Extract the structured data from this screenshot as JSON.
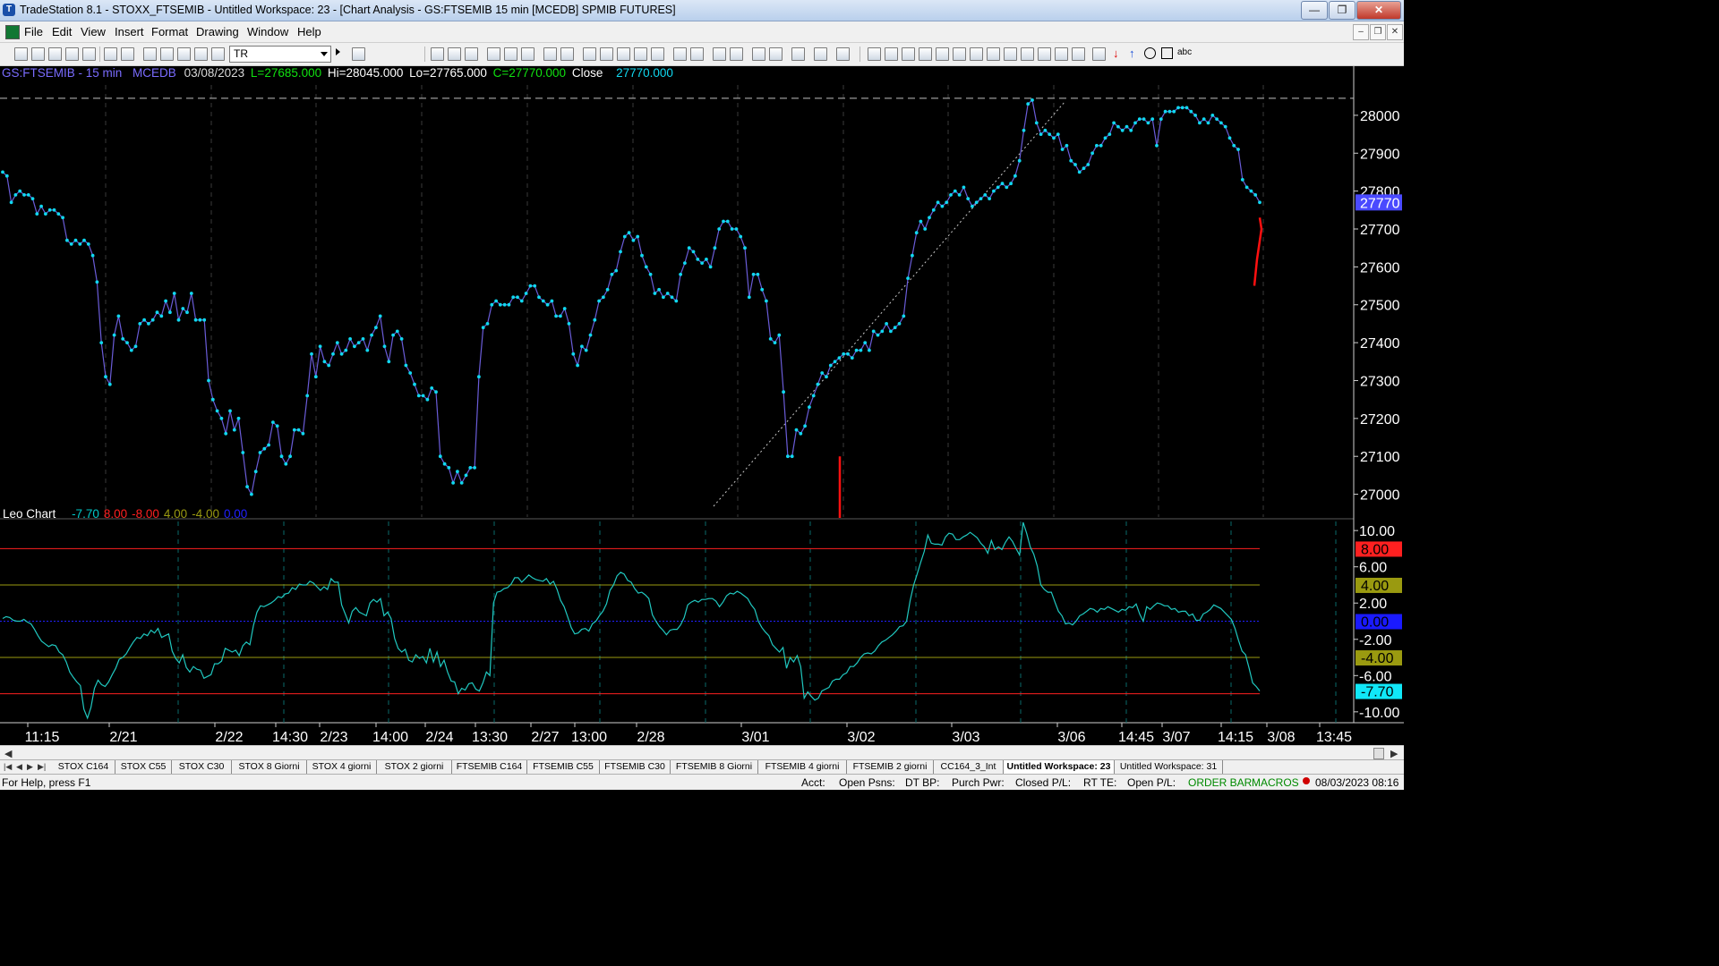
{
  "window": {
    "title": "TradeStation 8.1 - STOXX_FTSEMIB - Untitled Workspace:  23 - [Chart Analysis - GS:FTSEMIB  15 min  [MCEDB] SPMIB FUTURES]"
  },
  "menu": [
    "File",
    "Edit",
    "View",
    "Insert",
    "Format",
    "Drawing",
    "Window",
    "Help"
  ],
  "toolbar": {
    "symbol_value": "TR"
  },
  "chart_header": {
    "symbol": "GS:FTSEMIB - 15 min",
    "exchange": "MCEDB",
    "date": "03/08/2023",
    "last": "L=27685.000",
    "high": "Hi=28045.000",
    "low": "Lo=27765.000",
    "close_eq": "C=27770.000",
    "close_label": "Close",
    "close_value": "27770.000"
  },
  "indicator_header": {
    "name": "Leo Chart",
    "values": [
      {
        "text": "-7.70",
        "color": "#00c8c8"
      },
      {
        "text": "8.00",
        "color": "#ff2020"
      },
      {
        "text": "-8.00",
        "color": "#ff2020"
      },
      {
        "text": "4.00",
        "color": "#9a9a10"
      },
      {
        "text": "-4.00",
        "color": "#9a9a10"
      },
      {
        "text": "0.00",
        "color": "#2020ff"
      }
    ]
  },
  "colors": {
    "price_line": "#6a5cd8",
    "price_marker": "#10d8f0",
    "indicator": "#20c8c0",
    "up_level": "#ff2020",
    "mid_level": "#9a9a10",
    "zero_level": "#2020ff",
    "axis_text": "#ffffff",
    "red_bar": "#ff1010"
  },
  "price_axis": {
    "ticks": [
      "28000",
      "27900",
      "27800",
      "27700",
      "27600",
      "27500",
      "27400",
      "27300",
      "27200",
      "27100",
      "27000"
    ],
    "current_label": "27770"
  },
  "indicator_axis": {
    "ticks": [
      "10.00",
      "6.00",
      "2.00",
      "-2.00",
      "-6.00",
      "-10.00"
    ],
    "level_labels": [
      {
        "text": "8.00",
        "bg": "#ff2020",
        "fg": "#000000"
      },
      {
        "text": "4.00",
        "bg": "#9a9a10",
        "fg": "#000000"
      },
      {
        "text": "0.00",
        "bg": "#1a1aff",
        "fg": "#000000"
      },
      {
        "text": "-4.00",
        "bg": "#9a9a10",
        "fg": "#000000"
      },
      {
        "text": "-7.70",
        "bg": "#10e8f8",
        "fg": "#000000"
      }
    ]
  },
  "time_axis": [
    "11:15",
    "2/21",
    "2/22",
    "14:30",
    "2/23",
    "14:00",
    "2/24",
    "13:30",
    "2/27",
    "13:00",
    "2/28",
    "3/01",
    "3/02",
    "3/03",
    "3/06",
    "14:45",
    "3/07",
    "14:15",
    "3/08",
    "13:45"
  ],
  "tabs": [
    {
      "label": "STOX C164",
      "active": false
    },
    {
      "label": "STOX C55",
      "active": false
    },
    {
      "label": "STOX  C30",
      "active": false
    },
    {
      "label": "STOX  8 Giorni",
      "active": false
    },
    {
      "label": "STOX 4 giorni",
      "active": false
    },
    {
      "label": "STOX  2 giorni",
      "active": false
    },
    {
      "label": "FTSEMIB C164",
      "active": false
    },
    {
      "label": "FTSEMIB C55",
      "active": false
    },
    {
      "label": "FTSEMIB C30",
      "active": false
    },
    {
      "label": "FTSEMIB  8 Giorni",
      "active": false
    },
    {
      "label": "FTSEMIB  4 giorni",
      "active": false
    },
    {
      "label": "FTSEMIB  2 giorni",
      "active": false
    },
    {
      "label": "CC164_3_Int",
      "active": false
    },
    {
      "label": "Untitled Workspace:  23",
      "active": true
    },
    {
      "label": "Untitled Workspace:  31",
      "active": false
    }
  ],
  "status": {
    "help": "For Help, press F1",
    "acct": "Acct:",
    "open_psns": "Open Psns:",
    "dt_bp": "DT BP:",
    "purch_pwr": "Purch Pwr:",
    "closed_pl": "Closed P/L:",
    "rt_te": "RT TE:",
    "open_pl": "Open P/L:",
    "order_bar": "ORDER BAR",
    "macros": "MACROS",
    "datetime": "08/03/2023 08:16"
  },
  "chart_data": {
    "type": "line",
    "price_ylim": [
      26940,
      28080
    ],
    "indicator_ylim": [
      -11.2,
      11.2
    ],
    "price_series": {
      "name": "GS:FTSEMIB - 15 min",
      "values": [
        27850,
        27840,
        27770,
        27790,
        27800,
        27790,
        27790,
        27780,
        27740,
        27760,
        27740,
        27750,
        27750,
        27740,
        27730,
        27670,
        27660,
        27670,
        27660,
        27670,
        27660,
        27630,
        27560,
        27400,
        27310,
        27290,
        27420,
        27470,
        27410,
        27400,
        27380,
        27390,
        27450,
        27460,
        27450,
        27460,
        27480,
        27470,
        27510,
        27480,
        27530,
        27460,
        27490,
        27480,
        27530,
        27460,
        27460,
        27460,
        27300,
        27250,
        27220,
        27200,
        27160,
        27220,
        27170,
        27200,
        27110,
        27020,
        27000,
        27060,
        27110,
        27120,
        27130,
        27190,
        27180,
        27100,
        27080,
        27100,
        27170,
        27170,
        27160,
        27260,
        27370,
        27310,
        27390,
        27350,
        27340,
        27370,
        27400,
        27370,
        27380,
        27410,
        27390,
        27400,
        27410,
        27380,
        27420,
        27440,
        27470,
        27390,
        27350,
        27420,
        27430,
        27410,
        27340,
        27320,
        27290,
        27260,
        27260,
        27250,
        27280,
        27270,
        27100,
        27080,
        27070,
        27030,
        27060,
        27030,
        27050,
        27070,
        27070,
        27310,
        27440,
        27450,
        27500,
        27510,
        27500,
        27500,
        27500,
        27520,
        27520,
        27510,
        27530,
        27550,
        27550,
        27520,
        27510,
        27500,
        27510,
        27470,
        27470,
        27490,
        27450,
        27370,
        27340,
        27390,
        27380,
        27420,
        27460,
        27510,
        27520,
        27540,
        27580,
        27590,
        27640,
        27680,
        27690,
        27670,
        27680,
        27630,
        27600,
        27580,
        27530,
        27540,
        27520,
        27530,
        27520,
        27510,
        27580,
        27610,
        27650,
        27640,
        27620,
        27610,
        27620,
        27600,
        27650,
        27700,
        27720,
        27720,
        27700,
        27700,
        27680,
        27650,
        27520,
        27580,
        27580,
        27540,
        27510,
        27410,
        27400,
        27420,
        27270,
        27100,
        27100,
        27170,
        27160,
        27180,
        27230,
        27260,
        27290,
        27320,
        27310,
        27340,
        27350,
        27360,
        27370,
        27370,
        27360,
        27380,
        27380,
        27400,
        27380,
        27430,
        27420,
        27430,
        27450,
        27430,
        27440,
        27450,
        27470,
        27570,
        27630,
        27690,
        27720,
        27700,
        27730,
        27750,
        27770,
        27760,
        27770,
        27790,
        27800,
        27790,
        27810,
        27780,
        27760,
        27770,
        27780,
        27790,
        27780,
        27800,
        27810,
        27820,
        27810,
        27820,
        27840,
        27880,
        27960,
        28030,
        28040,
        27980,
        27950,
        27960,
        27950,
        27940,
        27950,
        27910,
        27920,
        27880,
        27870,
        27850,
        27860,
        27870,
        27900,
        27920,
        27920,
        27940,
        27950,
        27980,
        27970,
        27960,
        27970,
        27960,
        27980,
        27990,
        27990,
        27980,
        27990,
        27920,
        27990,
        28010,
        28010,
        28010,
        28020,
        28020,
        28020,
        28010,
        28000,
        27980,
        27990,
        27980,
        28000,
        27990,
        27980,
        27970,
        27940,
        27920,
        27910,
        27830,
        27810,
        27800,
        27790,
        27770
      ]
    },
    "indicator_series": {
      "name": "Leo Chart",
      "values": [
        0.3,
        0.5,
        0.4,
        0.1,
        0.0,
        0.0,
        0.2,
        -0.1,
        -0.3,
        -0.9,
        -1.6,
        -2.2,
        -2.5,
        -2.8,
        -2.6,
        -2.7,
        -3.4,
        -3.7,
        -4.5,
        -5.6,
        -6.2,
        -6.7,
        -7.1,
        -9.7,
        -10.7,
        -9.5,
        -7.4,
        -6.5,
        -7.0,
        -7.2,
        -6.7,
        -5.9,
        -5.2,
        -4.2,
        -4.0,
        -3.6,
        -2.9,
        -2.3,
        -1.8,
        -1.9,
        -1.4,
        -1.6,
        -1.0,
        -1.3,
        -0.8,
        -1.8,
        -1.6,
        -1.4,
        -3.3,
        -4.1,
        -4.6,
        -3.7,
        -5.1,
        -5.6,
        -5.0,
        -5.3,
        -5.4,
        -6.3,
        -6.1,
        -5.9,
        -4.7,
        -4.7,
        -4.4,
        -3.0,
        -3.2,
        -3.4,
        -3.2,
        -3.8,
        -2.7,
        -2.3,
        -2.6,
        -0.5,
        1.0,
        1.7,
        1.6,
        1.8,
        2.0,
        2.3,
        2.7,
        2.6,
        3.0,
        3.1,
        3.7,
        3.5,
        4.1,
        4.0,
        4.0,
        4.4,
        4.2,
        3.8,
        3.4,
        3.8,
        3.5,
        4.7,
        4.3,
        4.3,
        1.8,
        0.8,
        -0.2,
        1.1,
        1.5,
        1.0,
        0.8,
        0.6,
        2.0,
        2.4,
        2.1,
        2.5,
        0.6,
        1.0,
        0.3,
        -1.9,
        -3.0,
        -3.4,
        -3.1,
        -4.3,
        -4.5,
        -3.7,
        -4.1,
        -3.9,
        -4.6,
        -3.0,
        -4.5,
        -3.4,
        -5.0,
        -4.3,
        -5.6,
        -6.6,
        -6.7,
        -8.0,
        -7.4,
        -7.6,
        -6.9,
        -6.8,
        -7.5,
        -7.7,
        -6.8,
        -5.6,
        -6.0,
        2.0,
        3.2,
        3.3,
        3.6,
        3.7,
        4.1,
        4.8,
        4.8,
        4.3,
        4.7,
        5.1,
        4.8,
        4.6,
        4.5,
        4.4,
        4.7,
        4.1,
        4.4,
        3.5,
        2.3,
        1.6,
        0.5,
        -0.7,
        -1.4,
        -1.3,
        -0.9,
        -0.8,
        -1.1,
        -0.3,
        0.0,
        0.6,
        1.1,
        1.9,
        3.4,
        4.0,
        5.0,
        5.4,
        5.2,
        4.5,
        4.3,
        3.6,
        3.1,
        3.2,
        2.9,
        2.5,
        0.7,
        0.0,
        -0.6,
        -1.0,
        -1.5,
        -1.0,
        -0.9,
        -0.9,
        -0.4,
        0.4,
        1.8,
        2.1,
        2.3,
        2.1,
        2.4,
        2.4,
        2.5,
        2.5,
        2.2,
        1.6,
        2.1,
        2.8,
        3.1,
        3.0,
        3.3,
        3.1,
        2.8,
        2.5,
        1.8,
        1.3,
        0.0,
        -0.7,
        -1.2,
        -1.6,
        -2.6,
        -3.0,
        -3.4,
        -2.9,
        -5.2,
        -4.0,
        -4.5,
        -3.8,
        -5.0,
        -8.5,
        -7.8,
        -8.3,
        -8.7,
        -8.5,
        -7.7,
        -7.5,
        -7.3,
        -6.6,
        -6.4,
        -6.4,
        -5.9,
        -5.7,
        -5.0,
        -5.0,
        -4.6,
        -4.0,
        -3.6,
        -3.5,
        -3.6,
        -3.3,
        -2.7,
        -2.3,
        -2.1,
        -1.8,
        -1.5,
        -1.1,
        -0.6,
        -0.5,
        0.0,
        2.3,
        4.0,
        5.2,
        6.5,
        7.7,
        9.5,
        8.6,
        8.5,
        8.5,
        8.4,
        9.3,
        9.7,
        9.6,
        9.0,
        9.0,
        9.3,
        9.5,
        9.8,
        9.5,
        9.2,
        8.6,
        8.2,
        7.5,
        8.9,
        7.9,
        8.2,
        7.9,
        8.7,
        9.3,
        8.8,
        8.0,
        7.3,
        10.9,
        9.7,
        8.2,
        7.4,
        6.1,
        4.0,
        3.5,
        3.2,
        3.2,
        2.1,
        1.1,
        0.6,
        -0.3,
        -0.2,
        -0.4,
        0.0,
        0.6,
        0.8,
        1.1,
        1.4,
        1.3,
        1.0,
        1.4,
        1.3,
        1.6,
        1.4,
        1.2,
        1.0,
        1.3,
        1.2,
        1.6,
        1.5,
        1.9,
        0.8,
        0.0,
        1.6,
        1.3,
        1.7,
        2.0,
        1.9,
        1.7,
        1.7,
        1.3,
        1.4,
        1.0,
        1.1,
        1.1,
        0.6,
        0.8,
        0.1,
        0.1,
        0.8,
        1.0,
        1.3,
        1.8,
        1.6,
        1.4,
        1.0,
        0.6,
        0.2,
        -0.8,
        -2.1,
        -3.3,
        -3.7,
        -5.2,
        -6.8,
        -7.2,
        -7.7
      ]
    },
    "levels": [
      8,
      4,
      0,
      -4,
      -8
    ],
    "drawings": {
      "trendline": "dotted white",
      "dashed_high_line": true,
      "red_bars": 2
    }
  }
}
